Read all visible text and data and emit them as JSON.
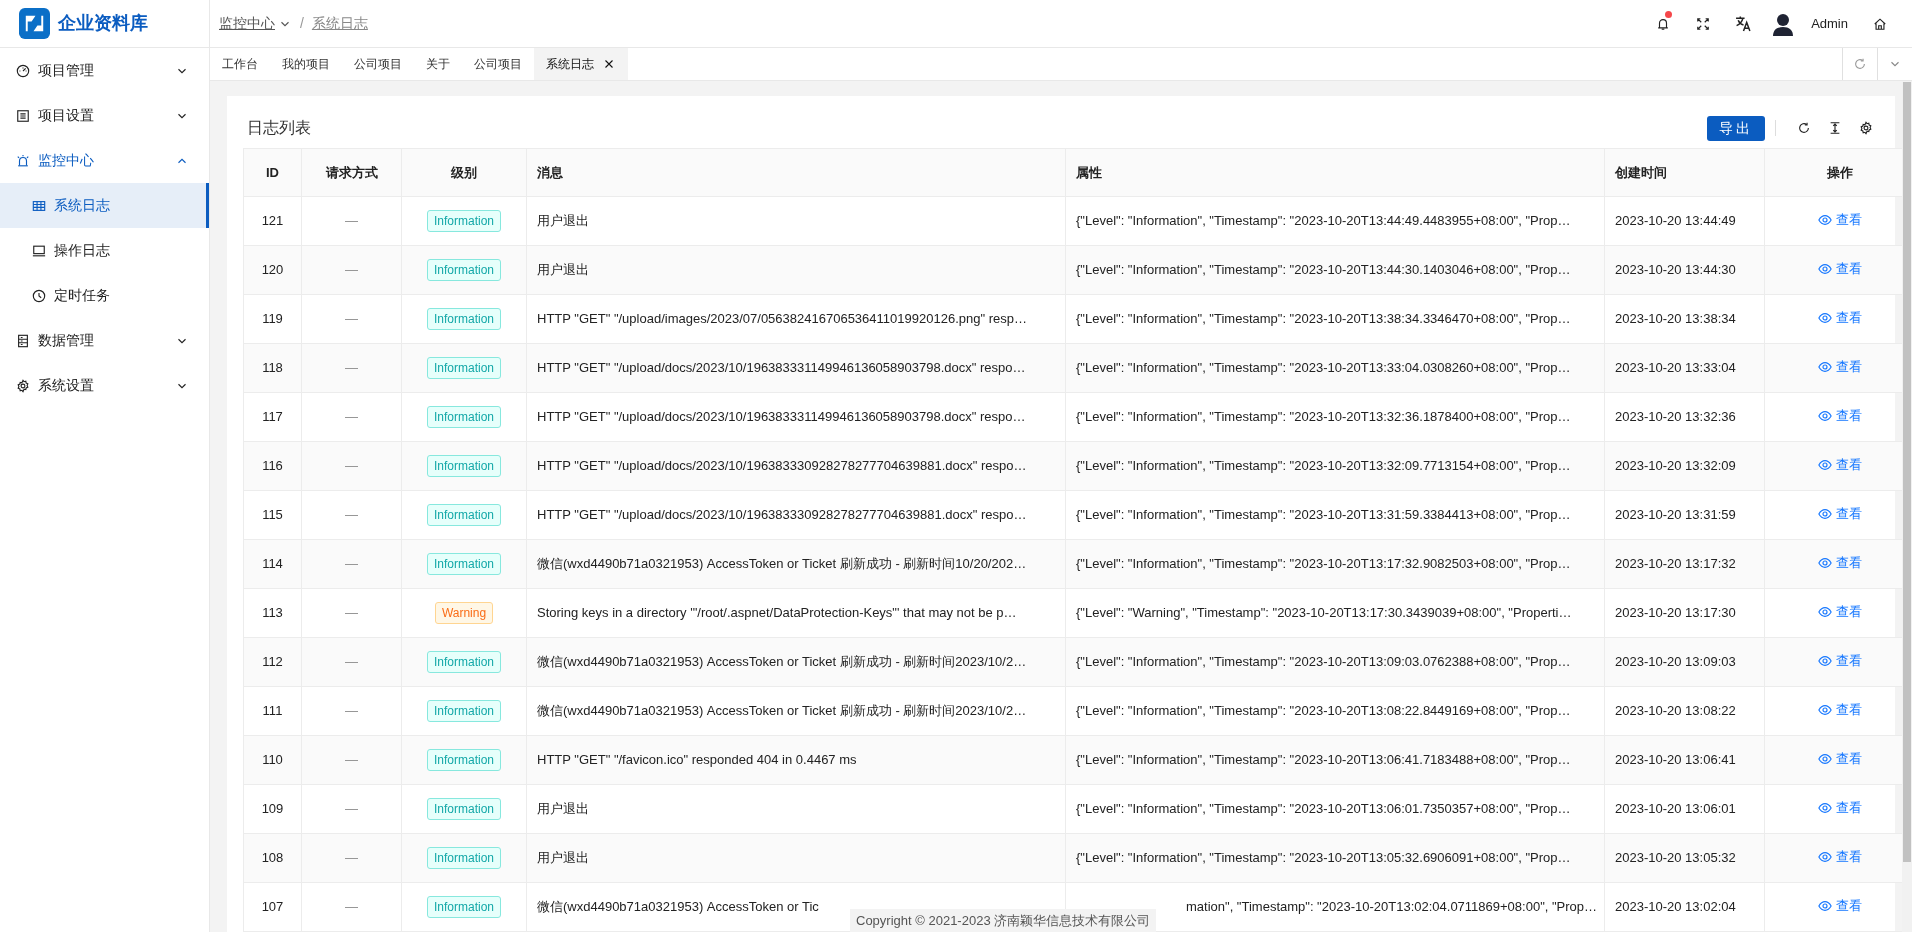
{
  "app": {
    "title": "企业资料库"
  },
  "breadcrumb_separator": "/",
  "breadcrumb": [
    {
      "label": "监控中心",
      "dropdown": true
    },
    {
      "label": "系统日志",
      "dropdown": false
    }
  ],
  "header": {
    "notifications": true,
    "user": "Admin"
  },
  "sidebar": {
    "items": [
      {
        "label": "项目管理",
        "expanded": false,
        "selected": false
      },
      {
        "label": "项目设置",
        "expanded": false,
        "selected": false
      },
      {
        "label": "监控中心",
        "expanded": true,
        "selected": false,
        "children": [
          {
            "label": "系统日志",
            "selected": true
          },
          {
            "label": "操作日志",
            "selected": false
          },
          {
            "label": "定时任务",
            "selected": false
          }
        ]
      },
      {
        "label": "数据管理",
        "expanded": false,
        "selected": false
      },
      {
        "label": "系统设置",
        "expanded": false,
        "selected": false
      }
    ]
  },
  "tabs": [
    {
      "label": "工作台",
      "selected": false,
      "closable": false
    },
    {
      "label": "我的项目",
      "selected": false,
      "closable": false
    },
    {
      "label": "公司项目",
      "selected": false,
      "closable": false
    },
    {
      "label": "关于",
      "selected": false,
      "closable": false
    },
    {
      "label": "公司项目",
      "selected": false,
      "closable": false
    },
    {
      "label": "系统日志",
      "selected": true,
      "closable": true
    }
  ],
  "card": {
    "title": "日志列表",
    "export_button": "导出"
  },
  "table": {
    "columns": [
      "ID",
      "请求方式",
      "级别",
      "消息",
      "属性",
      "创建时间",
      "操作"
    ],
    "rows": [
      {
        "id": "121",
        "method": "—",
        "level": "Information",
        "kind": "info",
        "message": "用户退出",
        "properties": "{\"Level\": \"Information\", \"Timestamp\": \"2023-10-20T13:44:49.4483955+08:00\", \"Prop…",
        "created": "2023-10-20 13:44:49",
        "action": "查看"
      },
      {
        "id": "120",
        "method": "—",
        "level": "Information",
        "kind": "info",
        "message": "用户退出",
        "properties": "{\"Level\": \"Information\", \"Timestamp\": \"2023-10-20T13:44:30.1403046+08:00\", \"Prop…",
        "created": "2023-10-20 13:44:30",
        "action": "查看"
      },
      {
        "id": "119",
        "method": "—",
        "level": "Information",
        "kind": "info",
        "message": "HTTP \"GET\" \"/upload/images/2023/07/056382416706536411019920126.png\" resp…",
        "properties": "{\"Level\": \"Information\", \"Timestamp\": \"2023-10-20T13:38:34.3346470+08:00\", \"Prop…",
        "created": "2023-10-20 13:38:34",
        "action": "查看"
      },
      {
        "id": "118",
        "method": "—",
        "level": "Information",
        "kind": "info",
        "message": "HTTP \"GET\" \"/upload/docs/2023/10/196383331149946136058903798.docx\" respo…",
        "properties": "{\"Level\": \"Information\", \"Timestamp\": \"2023-10-20T13:33:04.0308260+08:00\", \"Prop…",
        "created": "2023-10-20 13:33:04",
        "action": "查看"
      },
      {
        "id": "117",
        "method": "—",
        "level": "Information",
        "kind": "info",
        "message": "HTTP \"GET\" \"/upload/docs/2023/10/196383331149946136058903798.docx\" respo…",
        "properties": "{\"Level\": \"Information\", \"Timestamp\": \"2023-10-20T13:32:36.1878400+08:00\", \"Prop…",
        "created": "2023-10-20 13:32:36",
        "action": "查看"
      },
      {
        "id": "116",
        "method": "—",
        "level": "Information",
        "kind": "info",
        "message": "HTTP \"GET\" \"/upload/docs/2023/10/196383330928278277704639881.docx\" respo…",
        "properties": "{\"Level\": \"Information\", \"Timestamp\": \"2023-10-20T13:32:09.7713154+08:00\", \"Prop…",
        "created": "2023-10-20 13:32:09",
        "action": "查看"
      },
      {
        "id": "115",
        "method": "—",
        "level": "Information",
        "kind": "info",
        "message": "HTTP \"GET\" \"/upload/docs/2023/10/196383330928278277704639881.docx\" respo…",
        "properties": "{\"Level\": \"Information\", \"Timestamp\": \"2023-10-20T13:31:59.3384413+08:00\", \"Prop…",
        "created": "2023-10-20 13:31:59",
        "action": "查看"
      },
      {
        "id": "114",
        "method": "—",
        "level": "Information",
        "kind": "info",
        "message": "微信(wxd4490b71a0321953) AccessToken or Ticket 刷新成功 - 刷新时间10/20/202…",
        "properties": "{\"Level\": \"Information\", \"Timestamp\": \"2023-10-20T13:17:32.9082503+08:00\", \"Prop…",
        "created": "2023-10-20 13:17:32",
        "action": "查看"
      },
      {
        "id": "113",
        "method": "—",
        "level": "Warning",
        "kind": "warning",
        "message": "Storing keys in a directory '\"/root/.aspnet/DataProtection-Keys\"' that may not be p…",
        "properties": "{\"Level\": \"Warning\", \"Timestamp\": \"2023-10-20T13:17:30.3439039+08:00\", \"Properti…",
        "created": "2023-10-20 13:17:30",
        "action": "查看"
      },
      {
        "id": "112",
        "method": "—",
        "level": "Information",
        "kind": "info",
        "message": "微信(wxd4490b71a0321953) AccessToken or Ticket 刷新成功 - 刷新时间2023/10/2…",
        "properties": "{\"Level\": \"Information\", \"Timestamp\": \"2023-10-20T13:09:03.0762388+08:00\", \"Prop…",
        "created": "2023-10-20 13:09:03",
        "action": "查看"
      },
      {
        "id": "111",
        "method": "—",
        "level": "Information",
        "kind": "info",
        "message": "微信(wxd4490b71a0321953) AccessToken or Ticket 刷新成功 - 刷新时间2023/10/2…",
        "properties": "{\"Level\": \"Information\", \"Timestamp\": \"2023-10-20T13:08:22.8449169+08:00\", \"Prop…",
        "created": "2023-10-20 13:08:22",
        "action": "查看"
      },
      {
        "id": "110",
        "method": "—",
        "level": "Information",
        "kind": "info",
        "message": "HTTP \"GET\" \"/favicon.ico\" responded 404 in 0.4467 ms",
        "properties": "{\"Level\": \"Information\", \"Timestamp\": \"2023-10-20T13:06:41.7183488+08:00\", \"Prop…",
        "created": "2023-10-20 13:06:41",
        "action": "查看"
      },
      {
        "id": "109",
        "method": "—",
        "level": "Information",
        "kind": "info",
        "message": "用户退出",
        "properties": "{\"Level\": \"Information\", \"Timestamp\": \"2023-10-20T13:06:01.7350357+08:00\", \"Prop…",
        "created": "2023-10-20 13:06:01",
        "action": "查看"
      },
      {
        "id": "108",
        "method": "—",
        "level": "Information",
        "kind": "info",
        "message": "用户退出",
        "properties": "{\"Level\": \"Information\", \"Timestamp\": \"2023-10-20T13:05:32.6906091+08:00\", \"Prop…",
        "created": "2023-10-20 13:05:32",
        "action": "查看"
      },
      {
        "id": "107",
        "method": "—",
        "level": "Information",
        "kind": "info",
        "message": "微信(wxd4490b71a0321953) AccessToken or Tic",
        "properties": "mation\", \"Timestamp\": \"2023-10-20T13:02:04.0711869+08:00\", \"Prop…",
        "created": "2023-10-20 13:02:04",
        "action": "查看"
      }
    ]
  },
  "footer": {
    "copyright": "Copyright © 2021-2023 济南颖华信息技术有限公司"
  }
}
